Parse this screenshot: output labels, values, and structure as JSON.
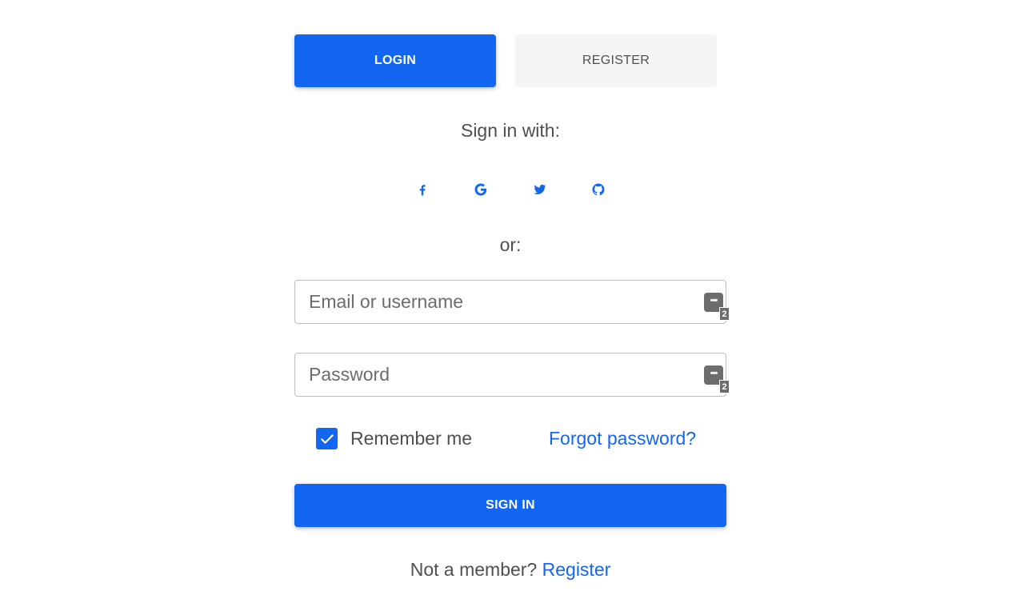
{
  "tabs": {
    "login_label": "LOGIN",
    "register_label": "REGISTER"
  },
  "social": {
    "heading": "Sign in with:",
    "icons": [
      "facebook-icon",
      "google-icon",
      "twitter-icon",
      "github-icon"
    ]
  },
  "or_text": "or:",
  "form": {
    "email_placeholder": "Email or username",
    "email_value": "",
    "password_placeholder": "Password",
    "password_value": "",
    "password_manager_badge": "2",
    "password_manager_badge_2": "2",
    "remember_label": "Remember me",
    "remember_checked": true,
    "forgot_label": "Forgot password?",
    "submit_label": "SIGN IN"
  },
  "footer": {
    "prompt": "Not a member?",
    "register_link": "Register"
  },
  "colors": {
    "accent": "#1266f1",
    "text": "#4f4f4f",
    "tab_inactive_bg": "#f5f5f5",
    "border": "#bdbdbd"
  }
}
